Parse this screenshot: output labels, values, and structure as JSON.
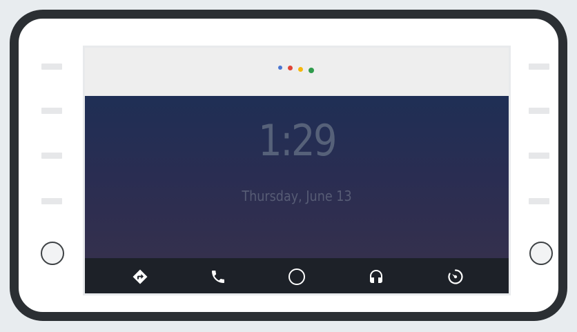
{
  "device": {
    "bezel_color": "#2b2f33",
    "left_buttons": 4,
    "right_buttons": 4
  },
  "assistant": {
    "icon": "google-assistant-dots-icon",
    "dot_colors": [
      "#4a75d1",
      "#e04436",
      "#f6b70d",
      "#2f9b4c"
    ]
  },
  "home": {
    "time": "1:29",
    "date": "Thursday, June 13",
    "text_color": "#566179"
  },
  "nav": {
    "items": [
      {
        "icon": "navigation-icon"
      },
      {
        "icon": "phone-icon"
      },
      {
        "icon": "home-icon"
      },
      {
        "icon": "headphones-icon"
      },
      {
        "icon": "overview-icon"
      }
    ],
    "icon_color": "#ffffff"
  }
}
